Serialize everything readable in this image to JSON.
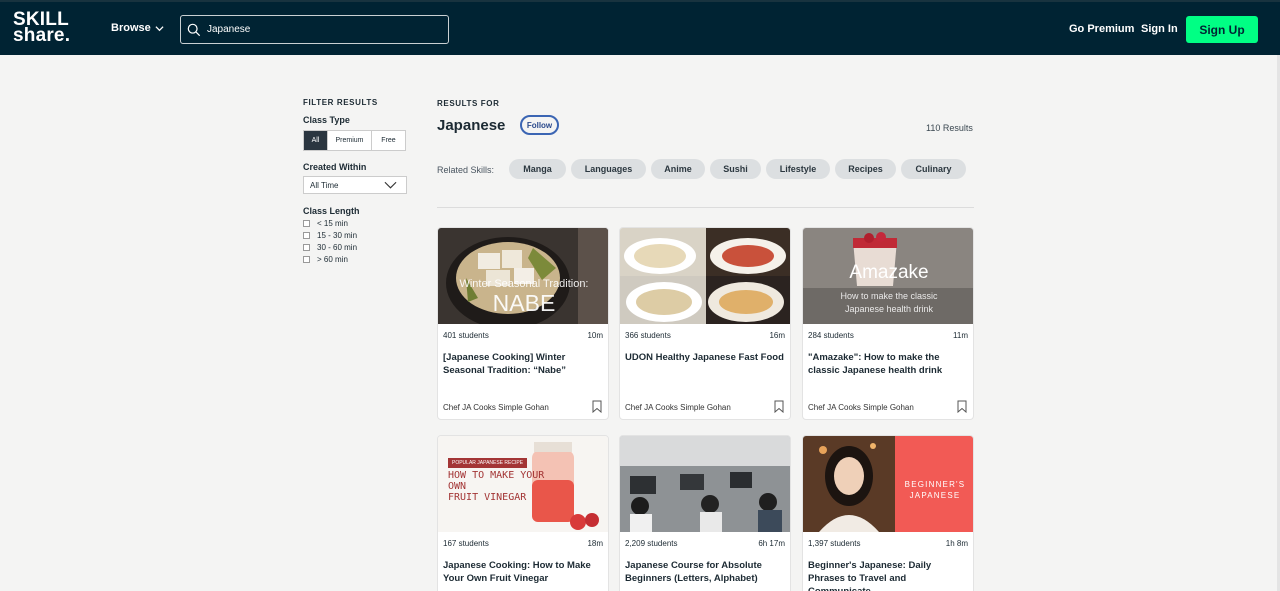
{
  "header": {
    "logo_line1": "SKILL",
    "logo_line2": "share.",
    "browse_label": "Browse",
    "search_value": "Japanese",
    "go_premium": "Go Premium",
    "sign_in": "Sign In",
    "sign_up": "Sign Up"
  },
  "filters": {
    "title": "FILTER RESULTS",
    "class_type_label": "Class Type",
    "class_types": [
      "All",
      "Premium",
      "Free"
    ],
    "created_within_label": "Created Within",
    "created_within_value": "All Time",
    "class_length_label": "Class Length",
    "lengths": [
      "< 15 min",
      "15 - 30 min",
      "30 - 60 min",
      "> 60 min"
    ]
  },
  "results": {
    "results_for": "RESULTS FOR",
    "query": "Japanese",
    "follow_label": "Follow",
    "count_text": "110 Results",
    "related_label": "Related Skills:",
    "related_skills": [
      "Manga",
      "Languages",
      "Anime",
      "Sushi",
      "Lifestyle",
      "Recipes",
      "Culinary"
    ]
  },
  "cards": [
    {
      "students": "401 students",
      "duration": "10m",
      "title": "[Japanese Cooking] Winter Seasonal Tradition: “Nabe”",
      "author": "Chef JA Cooks Simple Gohan",
      "thumb_line1": "Winter Seasonal Tradition:",
      "thumb_line2": "NABE"
    },
    {
      "students": "366 students",
      "duration": "16m",
      "title": "UDON Healthy Japanese Fast Food",
      "author": "Chef JA Cooks Simple Gohan"
    },
    {
      "students": "284 students",
      "duration": "11m",
      "title": "\"Amazake\": How to make the classic Japanese health drink",
      "author": "Chef JA Cooks Simple Gohan",
      "thumb_line1": "Amazake",
      "thumb_line2": "How to make the classic",
      "thumb_line3": "Japanese health drink"
    },
    {
      "students": "167 students",
      "duration": "18m",
      "title": "Japanese Cooking: How to Make Your Own Fruit Vinegar",
      "author": "",
      "thumb_line1": "POPULAR JAPANESE RECIPE",
      "thumb_line2": "HOW TO MAKE YOUR",
      "thumb_line3": "OWN",
      "thumb_line4": "FRUIT VINEGAR"
    },
    {
      "students": "2,209 students",
      "duration": "6h 17m",
      "title": "Japanese Course for Absolute Beginners (Letters, Alphabet)",
      "author": ""
    },
    {
      "students": "1,397 students",
      "duration": "1h 8m",
      "title": "Beginner's Japanese: Daily Phrases to Travel and Communicate",
      "author": "",
      "thumb_line1": "BEGINNER'S",
      "thumb_line2": "JAPANESE"
    }
  ],
  "colors": {
    "header_bg": "#002333",
    "signup_bg": "#00ff84",
    "follow_border": "#3b65b3"
  }
}
